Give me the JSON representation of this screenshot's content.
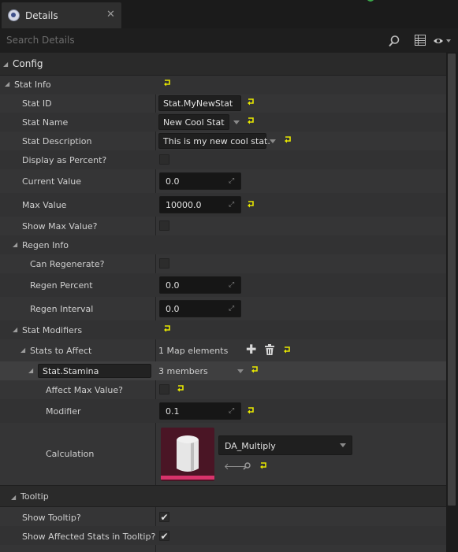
{
  "tab": {
    "label": "Details",
    "close": "✕"
  },
  "search": {
    "placeholder": "Search Details"
  },
  "categories": {
    "config": "Config",
    "tooltip": "Tooltip"
  },
  "stat_info": {
    "label": "Stat Info",
    "stat_id": {
      "label": "Stat ID",
      "value": "Stat.MyNewStat"
    },
    "stat_name": {
      "label": "Stat Name",
      "value": "New Cool Stat"
    },
    "stat_description": {
      "label": "Stat Description",
      "value": "This is my new cool stat."
    },
    "display_percent": {
      "label": "Display as Percent?",
      "checked": false
    },
    "current_value": {
      "label": "Current Value",
      "value": "0.0"
    },
    "max_value": {
      "label": "Max Value",
      "value": "10000.0"
    },
    "show_max": {
      "label": "Show Max Value?",
      "checked": false
    }
  },
  "regen_info": {
    "label": "Regen Info",
    "can_regenerate": {
      "label": "Can Regenerate?",
      "checked": false
    },
    "regen_percent": {
      "label": "Regen Percent",
      "value": "0.0"
    },
    "regen_interval": {
      "label": "Regen Interval",
      "value": "0.0"
    }
  },
  "stat_modifiers": {
    "label": "Stat Modifiers",
    "stats_to_affect": {
      "label": "Stats to Affect",
      "value": "1 Map elements"
    },
    "map_key": {
      "value": "Stat.Stamina",
      "members": "3 members"
    },
    "affect_max": {
      "label": "Affect Max Value?",
      "checked": false
    },
    "modifier": {
      "label": "Modifier",
      "value": "0.1"
    },
    "calculation": {
      "label": "Calculation",
      "asset": "DA_Multiply"
    }
  },
  "tooltip": {
    "show_tooltip": {
      "label": "Show Tooltip?",
      "checked": true
    },
    "show_affected": {
      "label": "Show Affected Stats in Tooltip?",
      "checked": true
    }
  },
  "glyphs": {
    "check": "✔",
    "plus": "✚",
    "arrow_left": "🡐",
    "spin": "⤢"
  },
  "colors": {
    "reset_arrow": "#e8e800",
    "asset_accent": "#d8336b"
  }
}
